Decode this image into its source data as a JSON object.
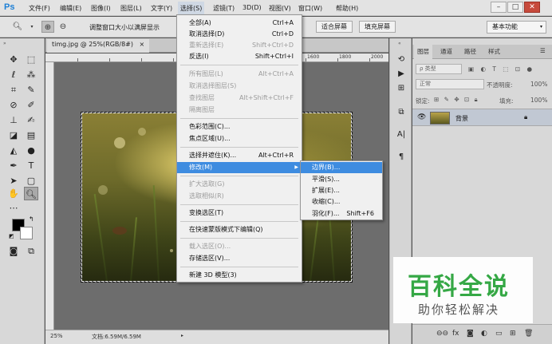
{
  "app": {
    "logo": "Ps"
  },
  "menubar": {
    "items": [
      "文件(F)",
      "编辑(E)",
      "图像(I)",
      "图层(L)",
      "文字(Y)",
      "选择(S)",
      "滤镜(T)",
      "3D(D)",
      "视图(V)",
      "窗口(W)",
      "帮助(H)"
    ],
    "active_index": 5,
    "window_controls": [
      "–",
      "□",
      "✕"
    ]
  },
  "options": {
    "fit_window_label": "调整窗口大小以满屏显示",
    "fit_screen_label": "适合屏幕",
    "fill_screen_label": "填充屏幕",
    "workspace": "基本功能"
  },
  "document": {
    "tab_title": "timg.jpg @ 25%(RGB/8#)",
    "tab_close": "×",
    "ruler_labels": [
      "1600",
      "1800",
      "2000"
    ],
    "zoom": "25%",
    "doc_size": "文档:6.59M/6.59M"
  },
  "select_menu": {
    "items": [
      {
        "label": "全部(A)",
        "shortcut": "Ctrl+A",
        "disabled": false
      },
      {
        "label": "取消选择(D)",
        "shortcut": "Ctrl+D",
        "disabled": false
      },
      {
        "label": "重新选择(E)",
        "shortcut": "Shift+Ctrl+D",
        "disabled": true
      },
      {
        "label": "反选(I)",
        "shortcut": "Shift+Ctrl+I",
        "disabled": false
      },
      {
        "label": "所有图层(L)",
        "shortcut": "Alt+Ctrl+A",
        "disabled": true
      },
      {
        "label": "取消选择图层(S)",
        "shortcut": "",
        "disabled": true
      },
      {
        "label": "查找图层",
        "shortcut": "Alt+Shift+Ctrl+F",
        "disabled": true
      },
      {
        "label": "隔离图层",
        "shortcut": "",
        "disabled": true
      },
      {
        "label": "色彩范围(C)...",
        "shortcut": "",
        "disabled": false
      },
      {
        "label": "焦点区域(U)...",
        "shortcut": "",
        "disabled": false
      },
      {
        "label": "选择并遮住(K)...",
        "shortcut": "Alt+Ctrl+R",
        "disabled": false
      },
      {
        "label": "修改(M)",
        "shortcut": "",
        "disabled": false,
        "highlighted": true,
        "submenu": true
      },
      {
        "label": "扩大选取(G)",
        "shortcut": "",
        "disabled": true
      },
      {
        "label": "选取相似(R)",
        "shortcut": "",
        "disabled": true
      },
      {
        "label": "变换选区(T)",
        "shortcut": "",
        "disabled": false
      },
      {
        "label": "在快速蒙版模式下编辑(Q)",
        "shortcut": "",
        "disabled": false
      },
      {
        "label": "载入选区(O)...",
        "shortcut": "",
        "disabled": true
      },
      {
        "label": "存储选区(V)...",
        "shortcut": "",
        "disabled": false
      },
      {
        "label": "新建 3D 模型(3)",
        "shortcut": "",
        "disabled": false
      }
    ]
  },
  "modify_submenu": {
    "items": [
      {
        "label": "边界(B)...",
        "shortcut": "",
        "highlighted": true
      },
      {
        "label": "平滑(S)...",
        "shortcut": ""
      },
      {
        "label": "扩展(E)...",
        "shortcut": ""
      },
      {
        "label": "收缩(C)...",
        "shortcut": ""
      },
      {
        "label": "羽化(F)...",
        "shortcut": "Shift+F6"
      }
    ]
  },
  "layers_panel": {
    "tabs": [
      "图层",
      "通道",
      "路径",
      "样式"
    ],
    "kind_filter": "ρ 类型",
    "blend_mode": "正常",
    "opacity_label": "不透明度:",
    "opacity_value": "100%",
    "lock_label": "锁定:",
    "fill_label": "填充:",
    "fill_value": "100%",
    "layer_name": "背景"
  },
  "watermark": {
    "title": "百科全说",
    "subtitle": "助你轻松解决"
  }
}
